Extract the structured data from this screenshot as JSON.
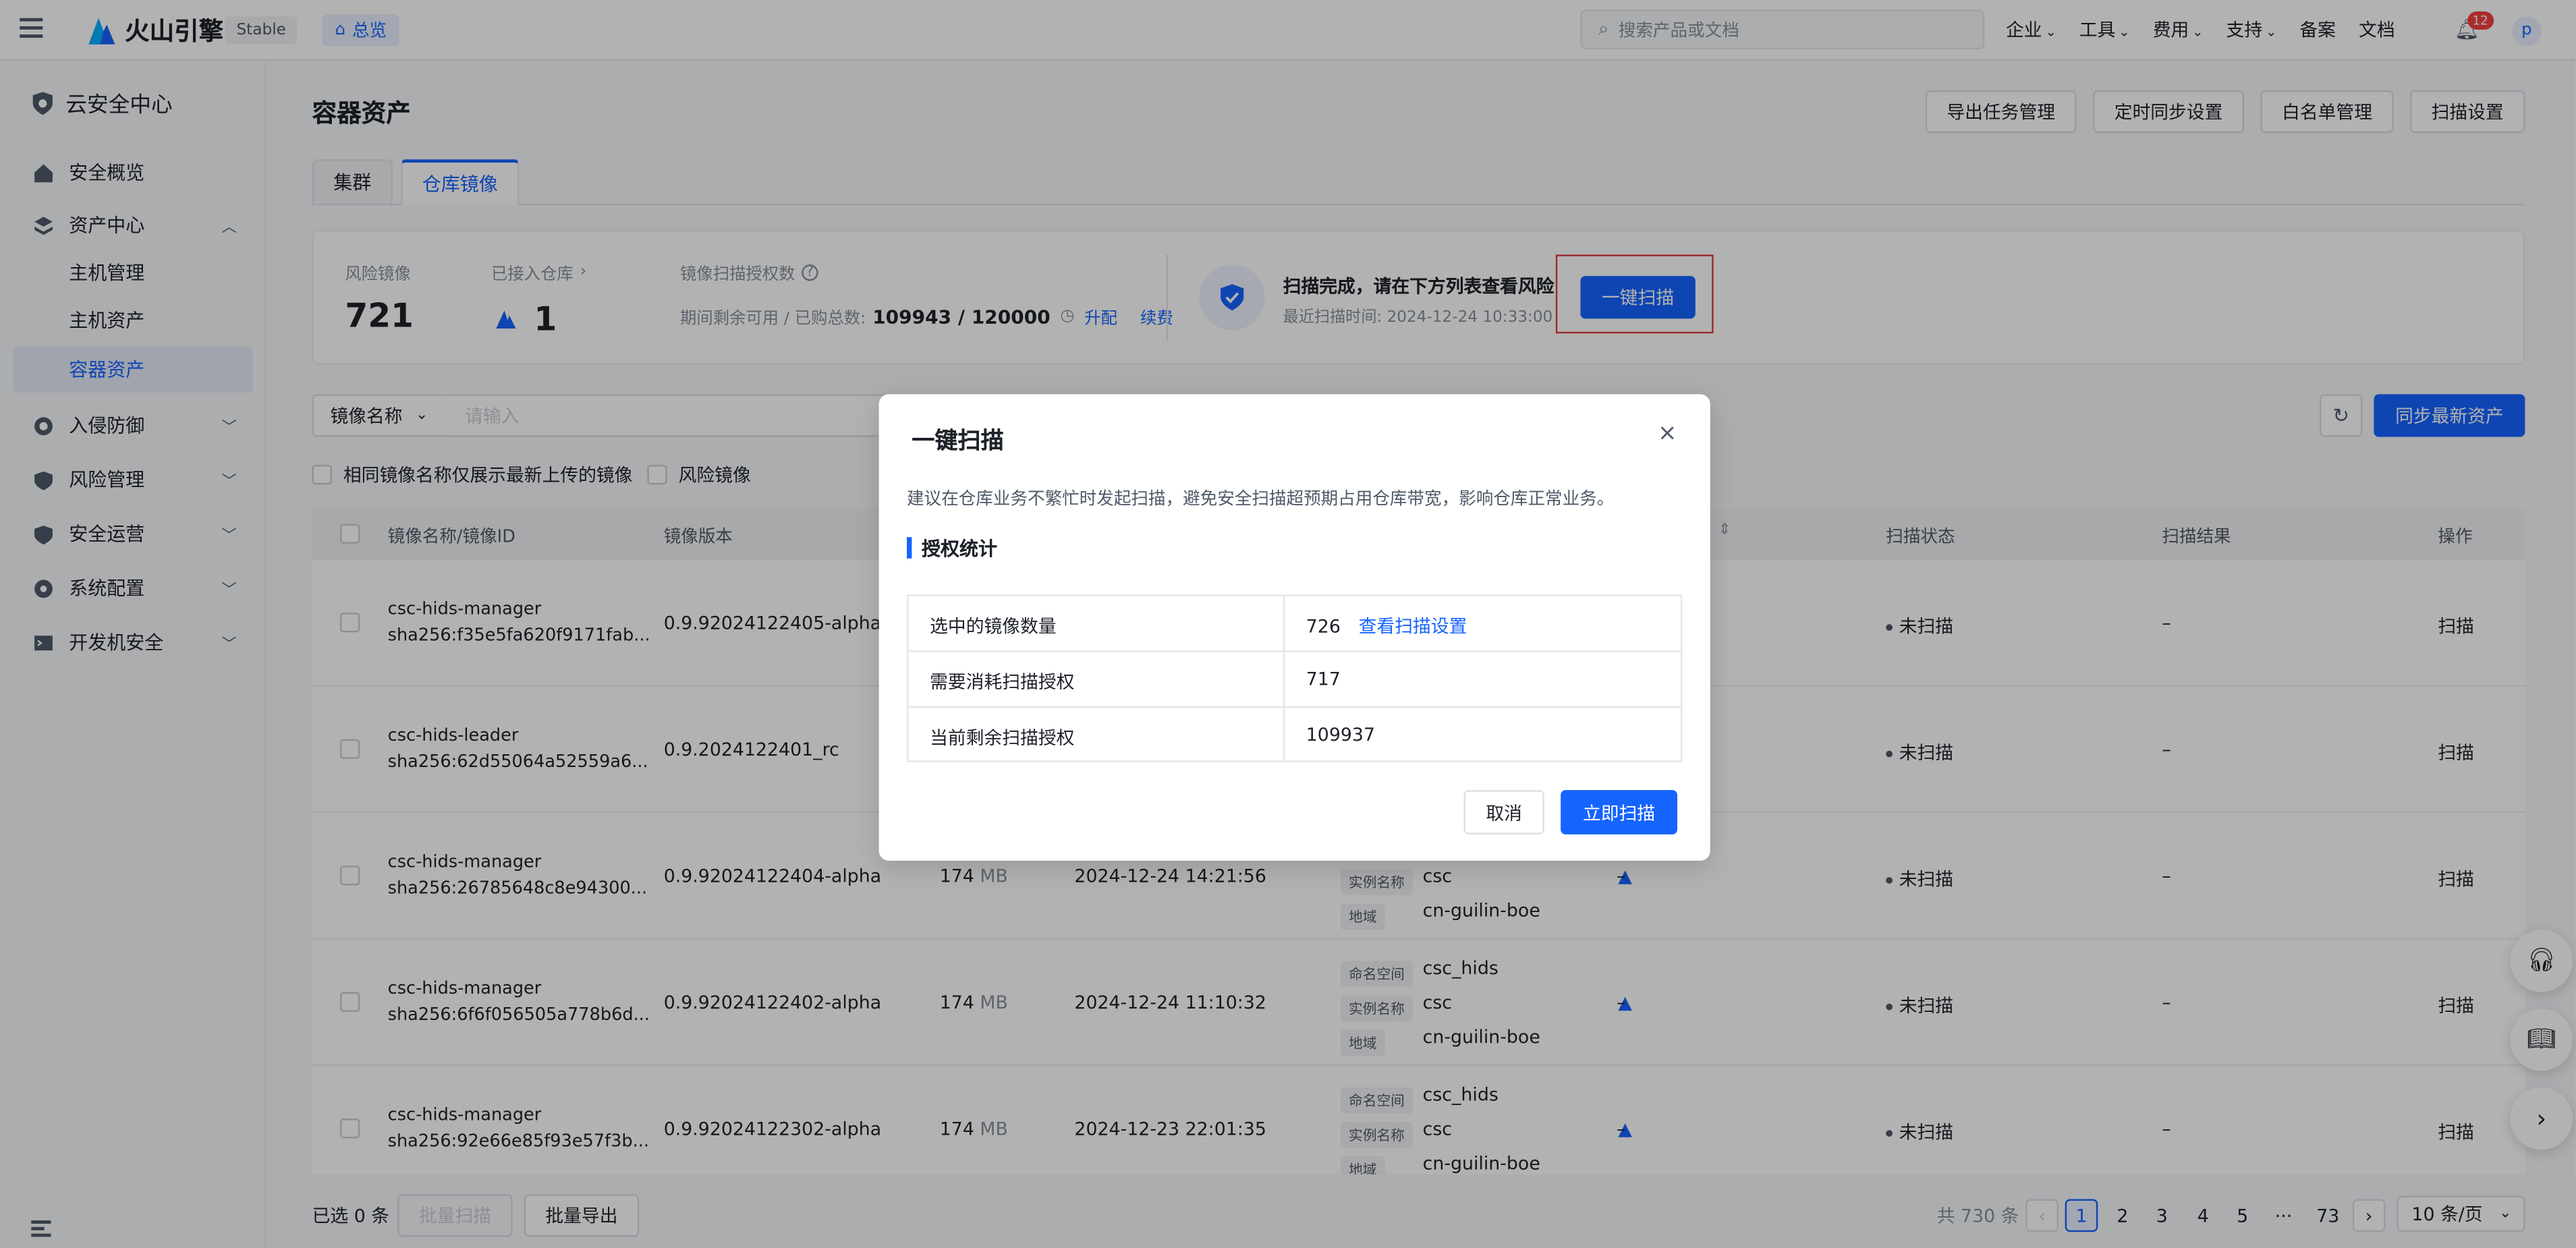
{
  "topbar": {
    "brand": "火山引擎",
    "env_badge": "Stable",
    "overview": "总览",
    "search_placeholder": "搜索产品或文档",
    "menu": [
      "企业",
      "工具",
      "费用",
      "支持"
    ],
    "beian": "备案",
    "docs": "文档",
    "notif_count": "12",
    "avatar": "p"
  },
  "sidebar": {
    "title": "云安全中心",
    "items": [
      {
        "label": "安全概览",
        "icon": "shield-home-icon"
      },
      {
        "label": "资产中心",
        "icon": "layers-icon",
        "expanded": true
      },
      {
        "label": "主机管理"
      },
      {
        "label": "主机资产"
      },
      {
        "label": "容器资产",
        "active": true
      },
      {
        "label": "入侵防御",
        "icon": "target-icon"
      },
      {
        "label": "风险管理",
        "icon": "shield-alert-icon"
      },
      {
        "label": "安全运营",
        "icon": "shield-check-icon"
      },
      {
        "label": "系统配置",
        "icon": "gear-icon"
      },
      {
        "label": "开发机安全",
        "icon": "terminal-icon"
      }
    ]
  },
  "page": {
    "title": "容器资产",
    "actions": [
      "导出任务管理",
      "定时同步设置",
      "白名单管理",
      "扫描设置"
    ],
    "tabs": [
      "集群",
      "仓库镜像"
    ],
    "active_tab": 1
  },
  "stats": {
    "risk_label": "风险镜像",
    "risk_value": "721",
    "repo_label": "已接入仓库",
    "repo_value": "1",
    "auth_label": "镜像扫描授权数",
    "auth_sub": "期间剩余可用 / 已购总数:",
    "auth_value": "109943 / 120000",
    "upgrade": "升配",
    "renew": "续费",
    "scan_status": "扫描完成，请在下方列表查看风险",
    "last_scan": "最近扫描时间:  2024-12-24 10:33:00",
    "scan_btn": "一键扫描"
  },
  "filters": {
    "field_select": "镜像名称",
    "input_placeholder": "请输入",
    "sync_btn": "同步最新资产",
    "opt1": "相同镜像名称仅展示最新上传的镜像",
    "opt2": "风险镜像"
  },
  "table": {
    "headers": [
      "镜像名称/镜像ID",
      "镜像版本",
      "扫描状态",
      "扫描结果",
      "操作"
    ],
    "meta_labels": [
      "命名空间",
      "实例名称",
      "地域"
    ],
    "rows": [
      {
        "name": "csc-hids-manager",
        "id": "sha256:f35e5fa620f9171fab...",
        "version": "0.9.92024122405-alpha",
        "size": "",
        "unit": "",
        "time": "",
        "ns": "",
        "inst": "",
        "region": "",
        "dash": "",
        "status": "未扫描",
        "result": "–",
        "action": "扫描"
      },
      {
        "name": "csc-hids-leader",
        "id": "sha256:62d55064a52559a6...",
        "version": "0.9.2024122401_rc",
        "size": "",
        "unit": "",
        "time": "",
        "ns": "",
        "inst": "",
        "region": "",
        "dash": "",
        "status": "未扫描",
        "result": "–",
        "action": "扫描"
      },
      {
        "name": "csc-hids-manager",
        "id": "sha256:26785648c8e94300...",
        "version": "0.9.92024122404-alpha",
        "size": "174",
        "unit": "MB",
        "time": "2024-12-24 14:21:56",
        "ns": "",
        "inst": "csc",
        "region": "cn-guilin-boe",
        "dash": "–",
        "status": "未扫描",
        "result": "–",
        "action": "扫描"
      },
      {
        "name": "csc-hids-manager",
        "id": "sha256:6f6f056505a778b6d...",
        "version": "0.9.92024122402-alpha",
        "size": "174",
        "unit": "MB",
        "time": "2024-12-24 11:10:32",
        "ns": "csc_hids",
        "inst": "csc",
        "region": "cn-guilin-boe",
        "dash": "–",
        "status": "未扫描",
        "result": "–",
        "action": "扫描"
      },
      {
        "name": "csc-hids-manager",
        "id": "sha256:92e66e85f93e57f3b...",
        "version": "0.9.92024122302-alpha",
        "size": "174",
        "unit": "MB",
        "time": "2024-12-23 22:01:35",
        "ns": "csc_hids",
        "inst": "csc",
        "region": "cn-guilin-boe",
        "dash": "–",
        "status": "未扫描",
        "result": "–",
        "action": "扫描"
      }
    ]
  },
  "footer": {
    "selected": "已选 0 条",
    "batch_scan": "批量扫描",
    "batch_export": "批量导出",
    "total": "共 730 条",
    "pages": [
      "1",
      "2",
      "3",
      "4",
      "5",
      "···",
      "73"
    ],
    "page_size": "10 条/页"
  },
  "modal": {
    "title": "一键扫描",
    "desc": "建议在仓库业务不繁忙时发起扫描，避免安全扫描超预期占用仓库带宽，影响仓库正常业务。",
    "section": "授权统计",
    "rows": [
      {
        "label": "选中的镜像数量",
        "value": "726",
        "link": "查看扫描设置"
      },
      {
        "label": "需要消耗扫描授权",
        "value": "717"
      },
      {
        "label": "当前剩余扫描授权",
        "value": "109937"
      }
    ],
    "cancel": "取消",
    "confirm": "立即扫描"
  },
  "colors": {
    "primary": "#1664ff",
    "highlight": "#e23c3c"
  }
}
